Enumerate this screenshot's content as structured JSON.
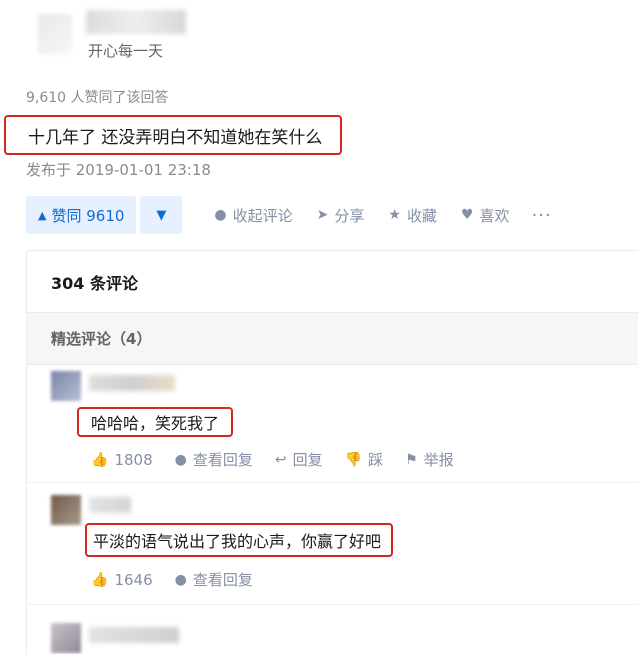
{
  "author": {
    "bio": "开心每一天"
  },
  "answer": {
    "agree_count_text": "9,610 人赞同了该回答",
    "text": "十几年了 还没弄明白不知道她在笑什么",
    "publish_time": "发布于 2019-01-01 23:18"
  },
  "actions": {
    "upvote_label": "赞同 9610",
    "upvote_icon": "▲",
    "downvote_icon": "▼",
    "collapse_comments": "收起评论",
    "share": "分享",
    "favorite": "收藏",
    "like": "喜欢",
    "more": "···"
  },
  "comments": {
    "header": "304 条评论",
    "featured_label": "精选评论（4）",
    "items": [
      {
        "text": "哈哈哈，笑死我了",
        "likes": "1808",
        "view_replies": "查看回复",
        "reply": "回复",
        "dislike": "踩",
        "report": "举报"
      },
      {
        "text": "平淡的语气说出了我的心声，你赢了好吧",
        "likes": "1646",
        "view_replies": "查看回复"
      }
    ]
  },
  "colors": {
    "accent": "#0f6bd6",
    "highlight_border": "#d5261f",
    "muted": "#8590a6"
  }
}
